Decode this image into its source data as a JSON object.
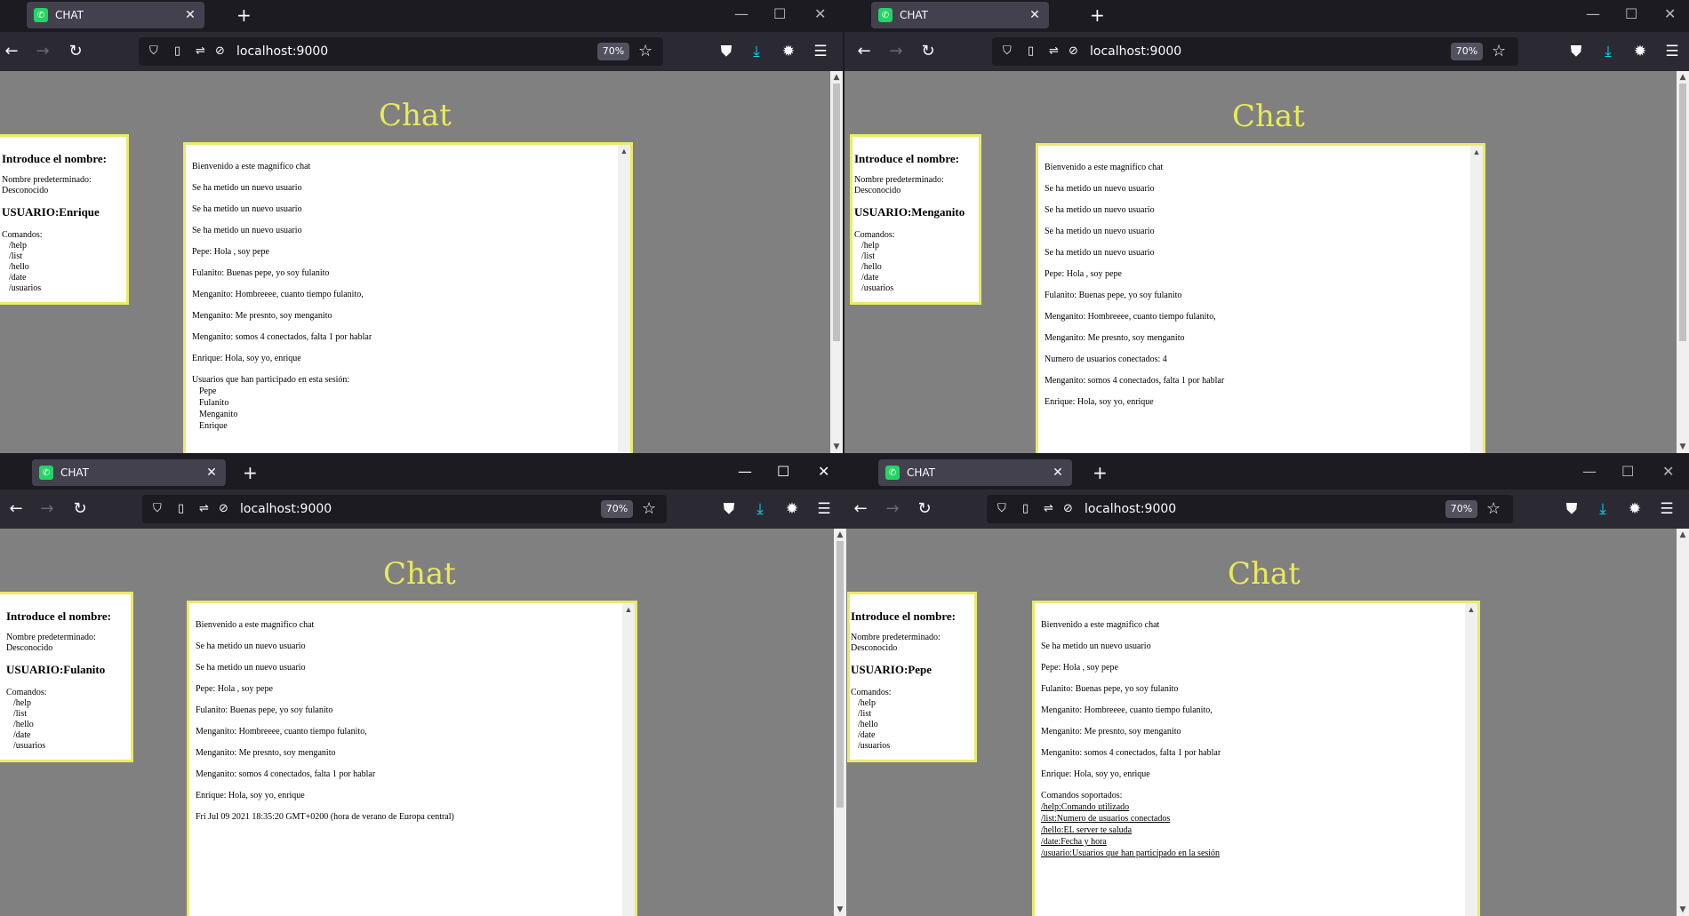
{
  "browser": {
    "tab_title": "CHAT",
    "url": "localhost:9000",
    "zoom": "70%"
  },
  "page": {
    "title": "Chat",
    "intro_heading": "Introduce el nombre:",
    "default_label": "Nombre predeterminado:",
    "default_value": "Desconocido",
    "commands_label": "Comandos:",
    "commands": [
      "/help",
      "/list",
      "/hello",
      "/date",
      "/usuarios"
    ]
  },
  "colors": {
    "title": "#e9e95a",
    "box_border": "#eaea6a",
    "page_bg": "#808080",
    "favicon": "#25d366"
  },
  "windows": [
    {
      "user": "USUARIO:Enrique",
      "messages": [
        "Bienvenido a este magnifico chat",
        "Se ha metido un nuevo usuario",
        "Se ha metido un nuevo usuario",
        "Se ha metido un nuevo usuario",
        "Pepe: Hola , soy pepe",
        "Fulanito: Buenas pepe, yo soy fulanito",
        "Menganito: Hombreeee, cuanto tiempo fulanito,",
        "Menganito: Me presnto, soy menganito",
        "Menganito: somos 4 conectados, falta 1 por hablar",
        "Enrique: Hola, soy yo, enrique"
      ],
      "participants_heading": "Usuarios que han participado en esta sesión:",
      "participants": [
        "Pepe",
        "Fulanito",
        "Menganito",
        "Enrique"
      ]
    },
    {
      "user": "USUARIO:Menganito",
      "messages": [
        "Bienvenido a este magnifico chat",
        "Se ha metido un nuevo usuario",
        "Se ha metido un nuevo usuario",
        "Se ha metido un nuevo usuario",
        "Se ha metido un nuevo usuario",
        "Pepe: Hola , soy pepe",
        "Fulanito: Buenas pepe, yo soy fulanito",
        "Menganito: Hombreeee, cuanto tiempo fulanito,",
        "Menganito: Me presnto, soy menganito",
        "Numero de usuarios conectados: 4",
        "Menganito: somos 4 conectados, falta 1 por hablar",
        "Enrique: Hola, soy yo, enrique"
      ]
    },
    {
      "user": "USUARIO:Fulanito",
      "messages": [
        "Bienvenido a este magnifico chat",
        "Se ha metido un nuevo usuario",
        "Se ha metido un nuevo usuario",
        "Pepe: Hola , soy pepe",
        "Fulanito: Buenas pepe, yo soy fulanito",
        "Menganito: Hombreeee, cuanto tiempo fulanito,",
        "Menganito: Me presnto, soy menganito",
        "Menganito: somos 4 conectados, falta 1 por hablar",
        "Enrique: Hola, soy yo, enrique",
        "Fri Jul 09 2021 18:35:20 GMT+0200 (hora de verano de Europa central)"
      ]
    },
    {
      "user": "USUARIO:Pepe",
      "messages": [
        "Bienvenido a este magnifico chat",
        "Se ha metido un nuevo usuario",
        "Pepe: Hola , soy pepe",
        "Fulanito: Buenas pepe, yo soy fulanito",
        "Menganito: Hombreeee, cuanto tiempo fulanito,",
        "Menganito: Me presnto, soy menganito",
        "Menganito: somos 4 conectados, falta 1 por hablar",
        "Enrique: Hola, soy yo, enrique"
      ],
      "supported_heading": "Comandos soportados:",
      "supported": [
        "/help:Comando utilizado",
        "/list:Numero de usuarios conectados",
        "/hello:EL server te saluda",
        "/date:Fecha y hora",
        "/usuario:Usuarios que han participado en la sesión"
      ]
    }
  ]
}
